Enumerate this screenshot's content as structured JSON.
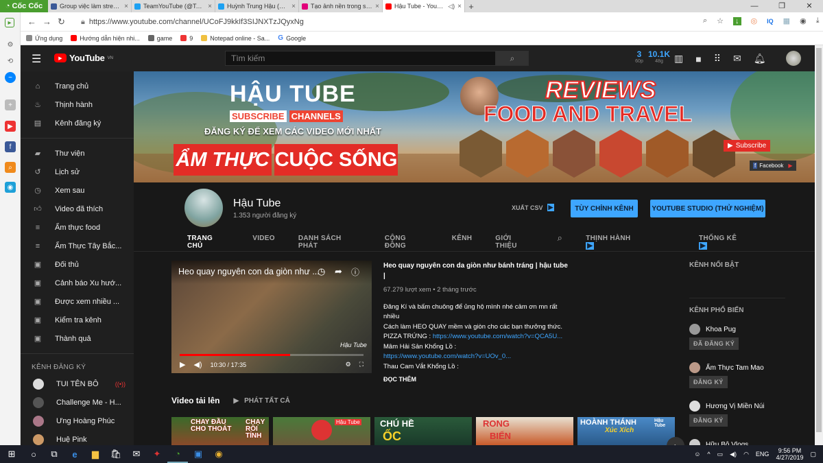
{
  "browser": {
    "brand": "Cốc Cốc",
    "tabs": [
      {
        "title": "Group việc làm streamer",
        "color": "#3b5998"
      },
      {
        "title": "TeamYouTube (@TeamYo",
        "color": "#1da1f2"
      },
      {
        "title": "Huỳnh Trung Hậu (@Hun",
        "color": "#1da1f2"
      },
      {
        "title": "Tạo ảnh nền trong suốt t",
        "color": "#e2007a"
      },
      {
        "title": "Hậu Tube - YouTube",
        "color": "#ff0000"
      }
    ],
    "url": "https://www.youtube.com/channel/UCoFJ9kkIf3SIJNXTzJQyxNg",
    "bookmarks": [
      {
        "label": "Ứng dụng",
        "color": "#888"
      },
      {
        "label": "Hướng dẫn hiện nhi...",
        "color": "#ff0000"
      },
      {
        "label": "game",
        "color": "#666"
      },
      {
        "label": "9",
        "color": "#e33"
      },
      {
        "label": "Notepad online - Sa...",
        "color": "#f0c040"
      },
      {
        "label": "Google",
        "color": "#4285f4"
      }
    ],
    "toolbar_counter": "IQ"
  },
  "youtube": {
    "logo": "YouTube",
    "region": "VN",
    "search_placeholder": "Tìm kiếm",
    "stats": [
      {
        "value": "3",
        "unit": "60p"
      },
      {
        "value": "10.1K",
        "unit": "48g"
      }
    ],
    "sidebar": {
      "main": [
        {
          "label": "Trang chủ",
          "icon": "home-icon"
        },
        {
          "label": "Thịnh hành",
          "icon": "trending-icon"
        },
        {
          "label": "Kênh đăng ký",
          "icon": "subscriptions-icon"
        }
      ],
      "library": [
        {
          "label": "Thư viện",
          "icon": "library-icon"
        },
        {
          "label": "Lịch sử",
          "icon": "history-icon"
        },
        {
          "label": "Xem sau",
          "icon": "watch-later-icon"
        },
        {
          "label": "Video đã thích",
          "icon": "like-icon"
        },
        {
          "label": "Ẩm thực food",
          "icon": "playlist-icon"
        },
        {
          "label": "Ẩm Thực Tây Bắc...",
          "icon": "playlist-icon"
        },
        {
          "label": "Đối thủ",
          "icon": "playlist-play-icon"
        },
        {
          "label": "Cảnh báo Xu hướ...",
          "icon": "playlist-play-icon"
        },
        {
          "label": "Được xem nhiều ...",
          "icon": "playlist-play-icon"
        },
        {
          "label": "Kiểm tra kênh",
          "icon": "playlist-play-icon"
        },
        {
          "label": "Thành quả",
          "icon": "playlist-play-icon"
        }
      ],
      "subs_header": "KÊNH ĐĂNG KÝ",
      "subs": [
        {
          "label": "TUI TÊN BÔ",
          "color": "#ddd"
        },
        {
          "label": "Challenge Me - H...",
          "color": "#555"
        },
        {
          "label": "Ưng Hoàng Phúc",
          "color": "#a78"
        },
        {
          "label": "Huệ Pink",
          "color": "#c96"
        }
      ]
    },
    "banner": {
      "title_a": "HẬU",
      "title_b": "TUBE",
      "subscribe_a": "SUBSCRIBE",
      "subscribe_b": "CHANNELS",
      "tagline": "ĐĂNG KÝ ĐỂ XEM CÁC VIDEO MỚI NHẤT",
      "left_big": "ẨM THỰC",
      "right_big": "CUỘC SỐNG",
      "reviews": "REVIEWS",
      "food_travel": "FOOD AND TRAVEL",
      "subscribe_badge": "Subscribe",
      "facebook": "Facebook"
    },
    "channel": {
      "name": "Hậu Tube",
      "subscribers": "1.353 người đăng ký",
      "export": "XUẤT CSV",
      "customize": "TÙY CHỈNH KÊNH",
      "studio": "YOUTUBE STUDIO (THỬ NGHIỆM)",
      "tabs": [
        "TRANG CHỦ",
        "VIDEO",
        "DANH SÁCH PHÁT",
        "CỘNG ĐỒNG",
        "KÊNH",
        "GIỚI THIỆU"
      ],
      "extra_tabs": [
        "THỊNH HÀNH",
        "THỐNG KÊ"
      ]
    },
    "featured": {
      "player_title": "Heo quay nguyên con da giòn như ...",
      "time": "10:30 / 17:35",
      "progress": 0.6,
      "watermark": "Hậu Tube",
      "title": "Heo quay nguyên con da giòn như bánh tráng | hậu tube |",
      "meta": "67.279 lượt xem • 2 tháng trước",
      "desc1": "Đăng Kí và bấm chuông để ủng hộ mình nhé cảm ơn mn rất nhiều",
      "desc2": "Cách làm HEO QUAY mềm và giòn cho các bạn thưởng thức.",
      "pizza_label": "PIZZA TRỨNG : ",
      "pizza_link": "https://www.youtube.com/watch?v=QCA5U...",
      "mam_label": "Mâm Hải Sản Khổng Lồ :",
      "mam_link": "https://www.youtube.com/watch?v=UOv_0...",
      "thau": "Thau Cam Vắt Khổng Lồ :",
      "more": "ĐỌC THÊM"
    },
    "uploads": {
      "title": "Video tải lên",
      "play_all": "PHÁT TẤT CẢ",
      "thumbs": [
        {
          "a": "CHAY ĐẦU",
          "b": "CHO THOÁT",
          "c": "CHẠY",
          "d": "RỒI",
          "e": "TÍNH"
        },
        {
          "a": "Hậu Tube",
          "b": ""
        },
        {
          "a": "CHÚ HỀ",
          "b": "ỐC"
        },
        {
          "a": "RONG",
          "b": "BIỂN"
        },
        {
          "a": "HOÀNH THÁNH",
          "b": "Xúc Xích",
          "c": "Hậu Tube"
        }
      ]
    },
    "right": {
      "featured_head": "KÊNH NỔI BẬT",
      "popular_head": "KÊNH PHỔ BIẾN",
      "channels": [
        {
          "name": "Khoa Pug",
          "btn": "ĐÃ ĐĂNG KÝ"
        },
        {
          "name": "Ẩm Thực Tam Mao",
          "btn": "ĐĂNG KÝ"
        },
        {
          "name": "Hương Vị Miền Núi",
          "btn": "ĐĂNG KÝ"
        },
        {
          "name": "Hữu Bô Vlogs",
          "btn": ""
        }
      ]
    }
  },
  "taskbar": {
    "lang": "ENG",
    "time": "9:56 PM",
    "date": "4/27/2019"
  }
}
